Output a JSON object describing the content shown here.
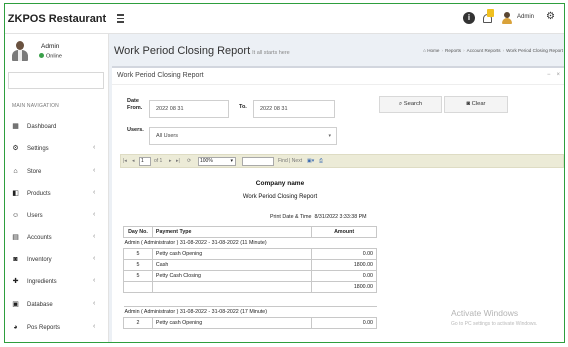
{
  "app": {
    "brand": "ZKPOS Restaurant",
    "admin_label": "Admin"
  },
  "sidebar": {
    "user_name": "Admin",
    "user_status": "Online",
    "nav_header": "MAIN NAVIGATION",
    "items": [
      {
        "label": "Dashboard",
        "icon": "dashboard-icon",
        "chevron": ""
      },
      {
        "label": "Settings",
        "icon": "gear-icon",
        "chevron": "‹"
      },
      {
        "label": "Store",
        "icon": "home-icon",
        "chevron": "‹"
      },
      {
        "label": "Products",
        "icon": "box-icon",
        "chevron": "‹"
      },
      {
        "label": "Users",
        "icon": "user-icon",
        "chevron": "‹"
      },
      {
        "label": "Accounts",
        "icon": "ledger-icon",
        "chevron": "‹"
      },
      {
        "label": "Inventory",
        "icon": "truck-icon",
        "chevron": "‹"
      },
      {
        "label": "Ingredients",
        "icon": "plus-icon",
        "chevron": "‹"
      },
      {
        "label": "Database",
        "icon": "database-icon",
        "chevron": "‹"
      },
      {
        "label": "Pos Reports",
        "icon": "chart-icon",
        "chevron": "‹"
      }
    ]
  },
  "header": {
    "title": "Work Period Closing Report",
    "subtitle": "It all starts here",
    "breadcrumbs": [
      "Home",
      "Reports",
      "Account Reports",
      "Work Period Closing Report"
    ]
  },
  "box": {
    "title": "Work Period Closing Report",
    "tool_collapse": "−",
    "tool_close": "×"
  },
  "filters": {
    "date_from_label": "Date From.",
    "date_from_value": "2022 08 31",
    "to_label": "To.",
    "date_to_value": "2022 08 31",
    "users_label": "Users.",
    "users_value": "All Users",
    "search_label": "Search",
    "clear_label": "Clear"
  },
  "report_toolbar": {
    "page_value": "1",
    "of_text": "of 1",
    "zoom_value": "100%",
    "find_text": "Find | Next"
  },
  "report": {
    "company": "Company name",
    "title": "Work Period Closing Report",
    "print_label": "Print Date & Time",
    "print_value": "8/31/2022 3:33:38 PM",
    "col_day": "Day No.",
    "col_type": "Payment Type",
    "col_amount": "Amount",
    "group1": {
      "header": "Admin ( Administrator ) 31-08-2022 - 31-08-2022 (11    Minute)",
      "rows": [
        {
          "day": "5",
          "type": "Petty cash Opening",
          "amount": "0.00"
        },
        {
          "day": "5",
          "type": "Cash",
          "amount": "1800.00"
        },
        {
          "day": "5",
          "type": "Petty Cash Closing",
          "amount": "0.00"
        }
      ],
      "total": "1800.00"
    },
    "group2": {
      "header": "Admin ( Administrator ) 31-08-2022 - 31-08-2022 (17    Minute)",
      "rows": [
        {
          "day": "2",
          "type": "Petty cash Opening",
          "amount": "0.00"
        }
      ]
    }
  },
  "watermark": {
    "line1": "Activate Windows",
    "line2": "Go to PC settings to activate Windows."
  }
}
